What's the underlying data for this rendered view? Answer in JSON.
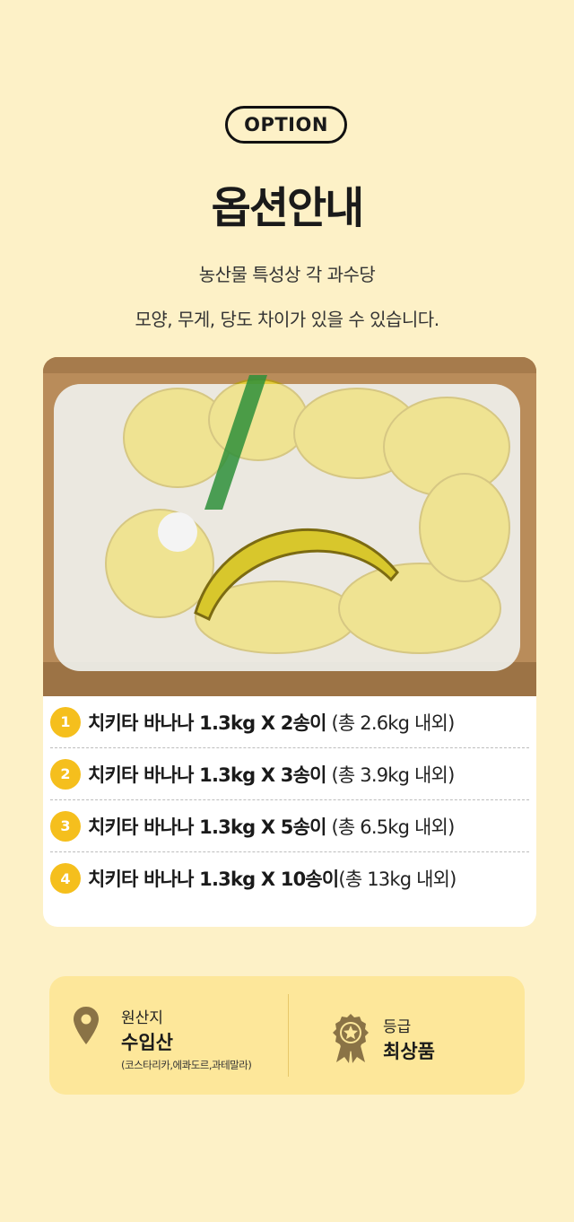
{
  "header": {
    "badge": "OPTION",
    "title": "옵션안내",
    "description_line1": "농산물 특성상 각 과수당",
    "description_line2": "모양, 무게, 당도 차이가 있을 수 있습니다."
  },
  "options": [
    {
      "number": "1",
      "main": "치키타 바나나 1.3kg X 2송이",
      "sub": " (총 2.6kg 내외)"
    },
    {
      "number": "2",
      "main": "치키타 바나나 1.3kg X 3송이",
      "sub": " (총 3.9kg 내외)"
    },
    {
      "number": "3",
      "main": "치키타 바나나 1.3kg X 5송이",
      "sub": " (총 6.5kg 내외)"
    },
    {
      "number": "4",
      "main": "치키타 바나나 1.3kg X 10송이",
      "sub": "(총 13kg 내외)"
    }
  ],
  "info": {
    "origin_label": "원산지",
    "origin_value": "수입산",
    "origin_note": "(코스타리카,에콰도르,과테말라)",
    "origin_icon": "location-pin-icon",
    "grade_label": "등급",
    "grade_value": "최상품",
    "grade_icon": "award-badge-icon"
  },
  "colors": {
    "background": "#fdf1c7",
    "accent": "#f5bf1d",
    "info_box": "#fde79a",
    "icon": "#8a7346"
  }
}
